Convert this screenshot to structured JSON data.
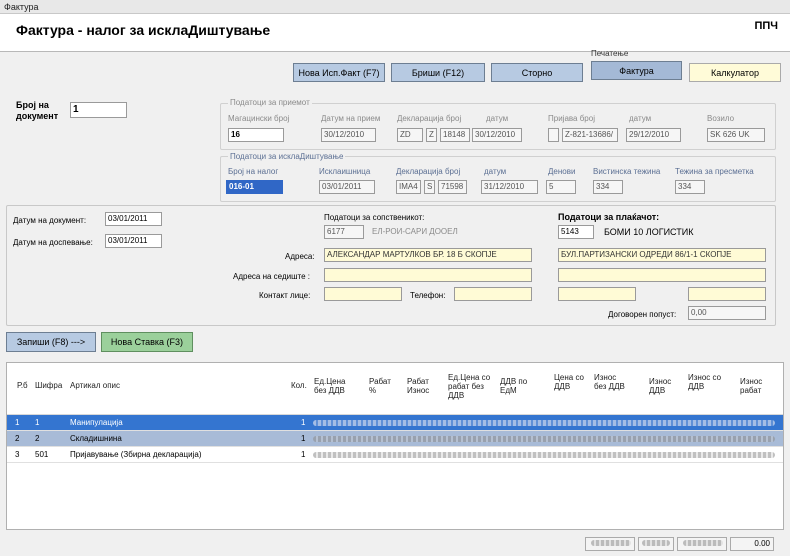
{
  "window": {
    "title": "Фактура"
  },
  "header": {
    "title": "Фактура - налог за исклаДиштување",
    "code": "ППЧ"
  },
  "toolbar": {
    "print_group_label": "Печатење",
    "new_btn": "Нова Исп.Факт (F7)",
    "delete_btn": "Бриши (F12)",
    "storno_btn": "Сторно",
    "invoice_btn": "Фактура",
    "calc_btn": "Калкулатор"
  },
  "doc": {
    "label": "Број на документ",
    "value": "1"
  },
  "receipt": {
    "title": "Податоци за приемот",
    "labels": [
      "Магацински број",
      "Датум на прием",
      "Декларација број",
      "датум",
      "Пријава број",
      "датум",
      "Возило"
    ],
    "warehouse_no": "16",
    "receipt_date": "30/12/2010",
    "decl_a": "ZD",
    "decl_b": "Z",
    "decl_c": "18148",
    "decl_date": "30/12/2010",
    "report_prefix": "",
    "report_no": "Z-821-13686/",
    "report_date": "29/12/2010",
    "vehicle": "SK 626 UK"
  },
  "storage": {
    "title": "Податоци за исклаДиштување",
    "labels": [
      "Број на налог",
      "Исклаишница",
      "Декларација број",
      "датум",
      "Денови",
      "Вистинска тежина",
      "Тежина за пресметка"
    ],
    "order_no": "016-01",
    "out_date": "03/01/2011",
    "decl_a": "IMA4",
    "decl_b": "S",
    "decl_c": "71598",
    "decl_date": "31/12/2010",
    "days": "5",
    "real_weight": "334",
    "calc_weight": "334"
  },
  "dates": {
    "doc_date_label": "Датум на документ:",
    "doc_date": "03/01/2011",
    "due_date_label": "Датум на доспевање:",
    "due_date": "03/01/2011"
  },
  "owner": {
    "label": "Податоци за сопственикот:",
    "code": "6177",
    "name": "ЕЛ-РОИ-САРИ ДООЕЛ"
  },
  "payer": {
    "label": "Податоци за плаќачот:",
    "code": "5143",
    "name": "БОМИ 10 ЛОГИСТИК"
  },
  "address": {
    "addr_label": "Адреса:",
    "owner_addr": "АЛЕКСАНДАР МАРТУЛКОВ БР. 18 Б СКОПЈЕ",
    "payer_addr": "БУЛ.ПАРТИЗАНСКИ ОДРЕДИ 86/1-1 СКОПЈЕ",
    "seat_label": "Адреса на седиште :",
    "contact_label": "Контакт лице:",
    "phone_label": "Телефон:",
    "discount_label": "Договорен попуст:",
    "discount": "0,00"
  },
  "actions": {
    "save_btn": "Запиши (F8) --->",
    "new_item_btn": "Нова Ставка (F3)"
  },
  "grid": {
    "headers": [
      "Р.б",
      "Шифра",
      "Артикал опис",
      "Кол.",
      "Ед.Цена без ДДВ",
      "Рабат %",
      "Рабат Износ",
      "Ед.Цена со рабат без ДДВ",
      "ДДВ по ЕдМ",
      "Цена со ДДВ",
      "Износ без ДДВ",
      "Износ ДДВ",
      "Износ со ДДВ",
      "Износ рабат"
    ],
    "rows": [
      {
        "rb": "1",
        "code": "1",
        "desc": "Манипулација",
        "qty": "1"
      },
      {
        "rb": "2",
        "code": "2",
        "desc": "Складишнина",
        "qty": "1"
      },
      {
        "rb": "3",
        "code": "501",
        "desc": "Пријавување (Збирна декларација)",
        "qty": "1"
      }
    ]
  },
  "status": {
    "total": "0.00"
  }
}
